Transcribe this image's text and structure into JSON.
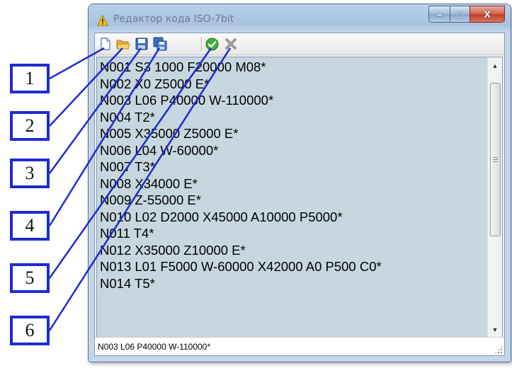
{
  "window": {
    "title": "Редактор кода ISO-7bit",
    "controls": {
      "minimize": "–",
      "maximize": "□",
      "close": "X"
    }
  },
  "toolbar": {
    "buttons": [
      {
        "name": "new-file",
        "icon": "new-document-icon"
      },
      {
        "name": "open-file",
        "icon": "folder-icon"
      },
      {
        "name": "save",
        "icon": "save-disk-icon"
      },
      {
        "name": "save-as",
        "icon": "save-as-icon"
      },
      {
        "name": "apply",
        "icon": "green-check-icon"
      },
      {
        "name": "cancel",
        "icon": "gray-x-icon"
      }
    ]
  },
  "editor": {
    "lines": [
      "N001 S3 1000 F20000 M08*",
      "N002 X0 Z5000 E*",
      "N003 L06 P40000 W-110000*",
      "N004 T2*",
      "N005 X35000 Z5000 E*",
      "N006 L04 W-60000*",
      "N007 T3*",
      "N008 X34000 E*",
      "N009 Z-55000 E*",
      "N010 L02 D2000 X45000 A10000 P5000*",
      "N011 T4*",
      "N012 X35000 Z10000 E*",
      "N013 L01 F5000 W-60000 X42000 A0 P500 C0*",
      "N014 T5*"
    ]
  },
  "status": {
    "text": "N003 L06 P40000 W-110000*"
  },
  "callouts": [
    "1",
    "2",
    "3",
    "4",
    "5",
    "6"
  ],
  "colors": {
    "callout_border": "#1f2bd1",
    "editor_background": "#c7d7df",
    "leader_line": "#1f2bd1"
  }
}
